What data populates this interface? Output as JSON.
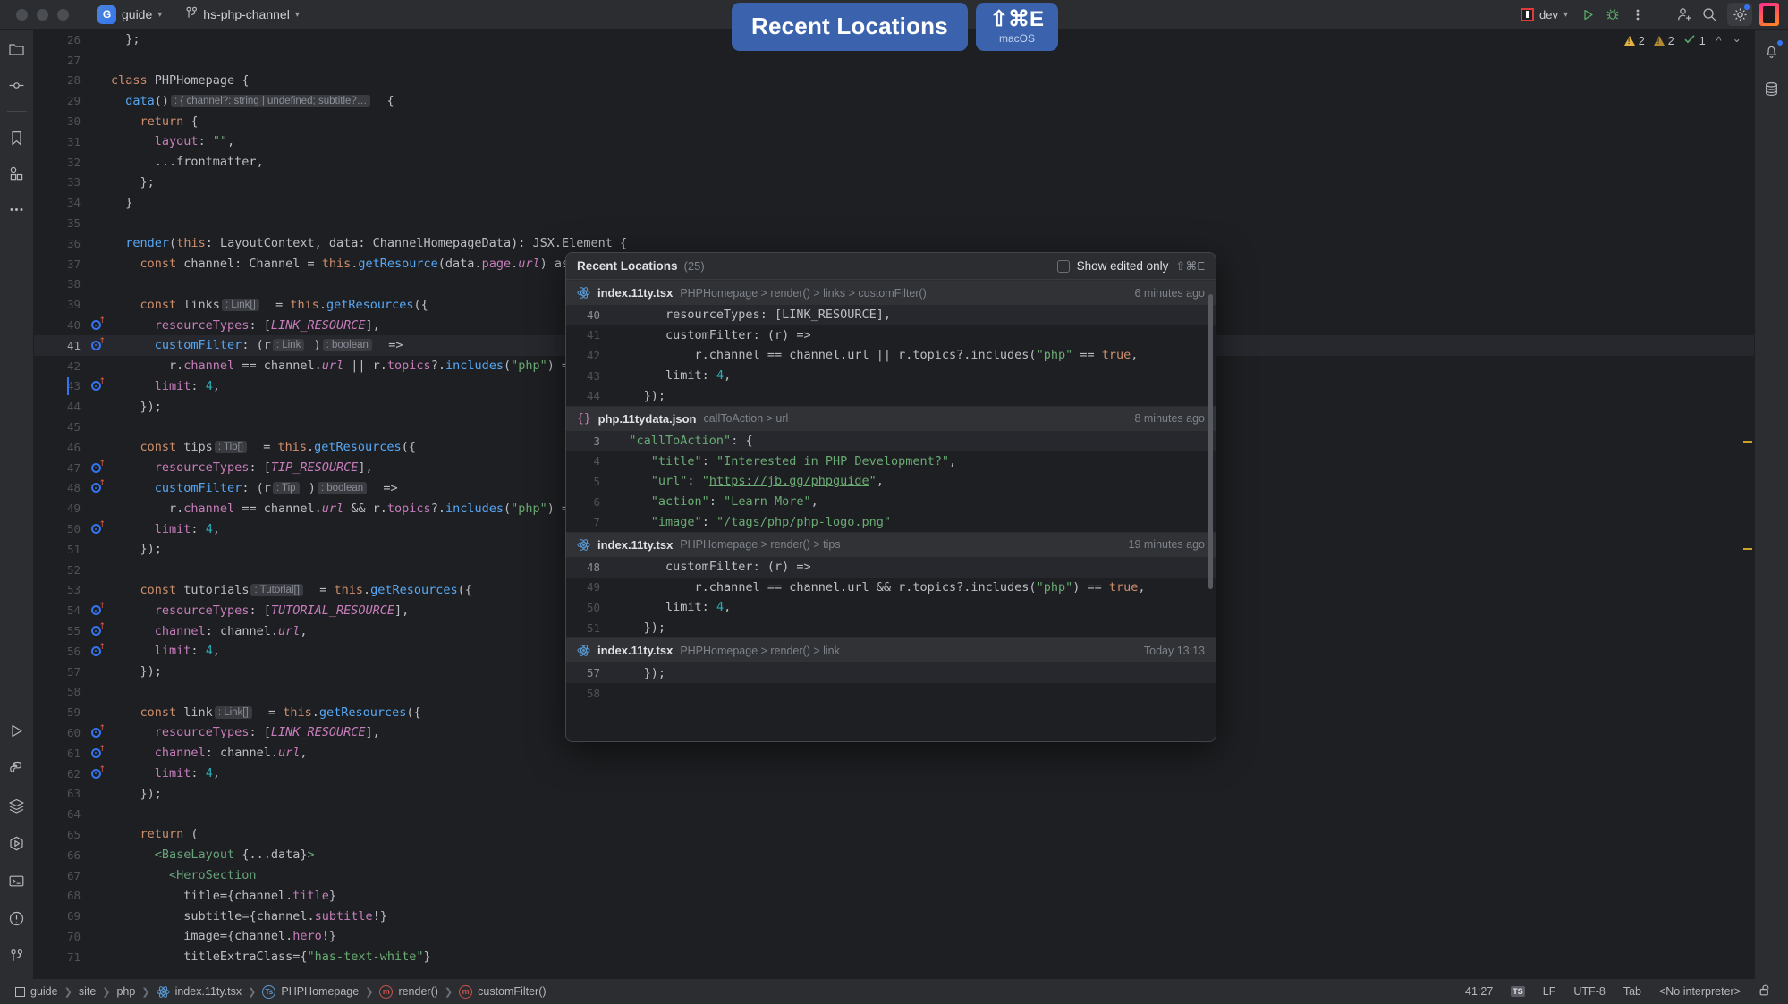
{
  "window": {
    "project_badge": "G",
    "project_name": "guide",
    "branch": "hs-php-channel"
  },
  "toolbar": {
    "run_config": "dev",
    "run_label": "run-icon",
    "debug_label": "debug-icon",
    "more_label": "more-options-icon",
    "search_label": "search-icon",
    "settings_label": "settings-icon",
    "add_user_label": "add-user-icon",
    "avatar_label": "user-avatar"
  },
  "banner": {
    "title": "Recent Locations",
    "shortcut": "⇧⌘E",
    "os": "macOS",
    "accent": "#3b63ad"
  },
  "inspections": {
    "warnings": "2",
    "weak_warnings": "2",
    "checks": "1"
  },
  "editor": {
    "file": "index.11ty.tsx",
    "lines": [
      {
        "n": "26",
        "marker": false,
        "html": "  <span class='def'>};</span>"
      },
      {
        "n": "27",
        "marker": false,
        "html": ""
      },
      {
        "n": "28",
        "marker": false,
        "html": "<span class='kw'>class</span> <span class='def'>PHPHomepage</span> {"
      },
      {
        "n": "29",
        "marker": false,
        "html": "  <span class='fn'>data</span>()<span class='hint'>: { channel?: string | undefined; subtitle?…</span>  {"
      },
      {
        "n": "30",
        "marker": false,
        "html": "    <span class='kw'>return</span> {"
      },
      {
        "n": "31",
        "marker": false,
        "html": "      <span class='prop'>layout</span>: <span class='str'>\"\"</span>,"
      },
      {
        "n": "32",
        "marker": false,
        "html": "      ...<span class='def'>frontmatter</span>,"
      },
      {
        "n": "33",
        "marker": false,
        "html": "    };"
      },
      {
        "n": "34",
        "marker": false,
        "html": "  }"
      },
      {
        "n": "35",
        "marker": false,
        "html": ""
      },
      {
        "n": "36",
        "marker": false,
        "html": "  <span class='fn'>render</span>(<span class='kw'>this</span>: LayoutContext, data: ChannelHomepageData): JSX.Element {"
      },
      {
        "n": "37",
        "marker": false,
        "html": "    <span class='kw'>const</span> channel: Channel = <span class='kw'>this</span>.<span class='fn'>getResource</span>(data.<span class='prop'>page</span>.<span class='const'>url</span>) as"
      },
      {
        "n": "38",
        "marker": false,
        "html": ""
      },
      {
        "n": "39",
        "marker": false,
        "html": "    <span class='kw'>const</span> <span class='def'>links</span><span class='hint'>: Link[]</span>  = <span class='kw'>this</span>.<span class='fn'>getResources</span>({"
      },
      {
        "n": "40",
        "marker": true,
        "html": "      <span class='prop'>resourceTypes</span>: [<span class='const'>LINK_RESOURCE</span>],"
      },
      {
        "n": "41",
        "marker": true,
        "html": "      <span class='fn'>customFilter</span>: (r<span class='hint'>: Link</span> )<span class='hint'>: boolean</span>  =>",
        "current": true
      },
      {
        "n": "42",
        "marker": false,
        "html": "        r.<span class='prop'>channel</span> == channel.<span class='const'>url</span> || r.<span class='prop'>topics</span>?.<span class='fn'>includes</span>(<span class='str'>\"php\"</span>) ="
      },
      {
        "n": "43",
        "marker": true,
        "html": "      <span class='prop'>limit</span>: <span class='num'>4</span>,",
        "caret": true
      },
      {
        "n": "44",
        "marker": false,
        "html": "    });"
      },
      {
        "n": "45",
        "marker": false,
        "html": ""
      },
      {
        "n": "46",
        "marker": false,
        "html": "    <span class='kw'>const</span> <span class='def'>tips</span><span class='hint'>: Tip[]</span>  = <span class='kw'>this</span>.<span class='fn'>getResources</span>({"
      },
      {
        "n": "47",
        "marker": true,
        "html": "      <span class='prop'>resourceTypes</span>: [<span class='const'>TIP_RESOURCE</span>],"
      },
      {
        "n": "48",
        "marker": true,
        "html": "      <span class='fn'>customFilter</span>: (r<span class='hint'>: Tip</span> )<span class='hint'>: boolean</span>  =>"
      },
      {
        "n": "49",
        "marker": false,
        "html": "        r.<span class='prop'>channel</span> == channel.<span class='const'>url</span> && r.<span class='prop'>topics</span>?.<span class='fn'>includes</span>(<span class='str'>\"php\"</span>) ="
      },
      {
        "n": "50",
        "marker": true,
        "html": "      <span class='prop'>limit</span>: <span class='num'>4</span>,"
      },
      {
        "n": "51",
        "marker": false,
        "html": "    });"
      },
      {
        "n": "52",
        "marker": false,
        "html": ""
      },
      {
        "n": "53",
        "marker": false,
        "html": "    <span class='kw'>const</span> <span class='def'>tutorials</span><span class='hint'>: Tutorial[]</span>  = <span class='kw'>this</span>.<span class='fn'>getResources</span>({"
      },
      {
        "n": "54",
        "marker": true,
        "html": "      <span class='prop'>resourceTypes</span>: [<span class='const'>TUTORIAL_RESOURCE</span>],"
      },
      {
        "n": "55",
        "marker": true,
        "html": "      <span class='prop'>channel</span>: channel.<span class='const'>url</span>,"
      },
      {
        "n": "56",
        "marker": true,
        "html": "      <span class='prop'>limit</span>: <span class='num'>4</span>,"
      },
      {
        "n": "57",
        "marker": false,
        "html": "    });"
      },
      {
        "n": "58",
        "marker": false,
        "html": ""
      },
      {
        "n": "59",
        "marker": false,
        "html": "    <span class='kw'>const</span> <span class='def'>link</span><span class='hint'>: Link[]</span>  = <span class='kw'>this</span>.<span class='fn'>getResources</span>({"
      },
      {
        "n": "60",
        "marker": true,
        "html": "      <span class='prop'>resourceTypes</span>: [<span class='const'>LINK_RESOURCE</span>],"
      },
      {
        "n": "61",
        "marker": true,
        "html": "      <span class='prop'>channel</span>: channel.<span class='const'>url</span>,"
      },
      {
        "n": "62",
        "marker": true,
        "html": "      <span class='prop'>limit</span>: <span class='num'>4</span>,"
      },
      {
        "n": "63",
        "marker": false,
        "html": "    });"
      },
      {
        "n": "64",
        "marker": false,
        "html": ""
      },
      {
        "n": "65",
        "marker": false,
        "html": "    <span class='kw'>return</span> ("
      },
      {
        "n": "66",
        "marker": false,
        "html": "      <span class='tag'>&lt;BaseLayout</span> {...data}<span class='tag'>&gt;</span>"
      },
      {
        "n": "67",
        "marker": false,
        "html": "        <span class='tag'>&lt;HeroSection</span>"
      },
      {
        "n": "68",
        "marker": false,
        "html": "          <span class='attr'>title</span>={channel.<span class='prop'>title</span>}"
      },
      {
        "n": "69",
        "marker": false,
        "html": "          <span class='attr'>subtitle</span>={channel.<span class='prop'>subtitle</span>!}"
      },
      {
        "n": "70",
        "marker": false,
        "html": "          <span class='attr'>image</span>={channel.<span class='prop'>hero</span>!}"
      },
      {
        "n": "71",
        "marker": false,
        "html": "          <span class='attr'>titleExtraClass</span>={<span class='str'>\"has-text-white\"</span>}"
      }
    ]
  },
  "popup": {
    "title": "Recent Locations",
    "count": "(25)",
    "filter_label": "Show edited only",
    "filter_shortcut": "⇧⌘E",
    "filter_checked": false,
    "groups": [
      {
        "icon": "react-icon",
        "file": "index.11ty.tsx",
        "breadcrumb": "PHPHomepage > render() > links > customFilter()",
        "time": "6 minutes ago",
        "lines": [
          {
            "n": "40",
            "lit": true,
            "html": "        <span class='ptext'>resourceTypes: [LINK_RESOURCE],</span>"
          },
          {
            "n": "41",
            "lit": false,
            "html": "        <span class='ptext'>customFilter: (r) =&gt;</span>"
          },
          {
            "n": "42",
            "lit": false,
            "html": "            <span class='ptext'>r.channel == channel.url || r.topics?.includes(</span><span class='str'>\"php\"</span><span class='ptext'> == </span><span class='kw'>true</span><span class='ptext'>,</span>"
          },
          {
            "n": "43",
            "lit": false,
            "html": "        <span class='ptext'>limit: </span><span class='num'>4</span><span class='ptext'>,</span>"
          },
          {
            "n": "44",
            "lit": false,
            "html": "     <span class='ptext'>});</span>"
          }
        ]
      },
      {
        "icon": "json-icon",
        "file": "php.11tydata.json",
        "breadcrumb": "callToAction > url",
        "time": "8 minutes ago",
        "lines": [
          {
            "n": "3",
            "lit": true,
            "html": "   <span class='str'>\"callToAction\"</span><span class='ptext'>: {</span>"
          },
          {
            "n": "4",
            "lit": false,
            "html": "      <span class='str'>\"title\"</span><span class='ptext'>: </span><span class='str'>\"Interested in PHP Development?\"</span><span class='ptext'>,</span>"
          },
          {
            "n": "5",
            "lit": false,
            "html": "      <span class='str'>\"url\"</span><span class='ptext'>: </span><span class='str'>\"</span><span class='link-u'>https://jb.gg/phpguide</span><span class='str'>\"</span><span class='ptext'>,</span>"
          },
          {
            "n": "6",
            "lit": false,
            "html": "      <span class='str'>\"action\"</span><span class='ptext'>: </span><span class='str'>\"Learn More\"</span><span class='ptext'>,</span>"
          },
          {
            "n": "7",
            "lit": false,
            "html": "      <span class='str'>\"image\"</span><span class='ptext'>: </span><span class='str'>\"/tags/php/php-logo.png\"</span>"
          }
        ]
      },
      {
        "icon": "react-icon",
        "file": "index.11ty.tsx",
        "breadcrumb": "PHPHomepage > render() > tips",
        "time": "19 minutes ago",
        "lines": [
          {
            "n": "48",
            "lit": true,
            "html": "        <span class='ptext'>customFilter: (r) =&gt;</span>"
          },
          {
            "n": "49",
            "lit": false,
            "html": "            <span class='ptext'>r.channel == channel.url &amp;&amp; r.topics?.includes(</span><span class='str'>\"php\"</span><span class='ptext'>) == </span><span class='kw'>true</span><span class='ptext'>,</span>"
          },
          {
            "n": "50",
            "lit": false,
            "html": "        <span class='ptext'>limit: </span><span class='num'>4</span><span class='ptext'>,</span>"
          },
          {
            "n": "51",
            "lit": false,
            "html": "     <span class='ptext'>});</span>"
          }
        ]
      },
      {
        "icon": "react-icon",
        "file": "index.11ty.tsx",
        "breadcrumb": "PHPHomepage > render() > link",
        "time": "Today 13:13",
        "lines": [
          {
            "n": "57",
            "lit": true,
            "html": "     <span class='ptext'>});</span>"
          },
          {
            "n": "58",
            "lit": false,
            "html": ""
          }
        ]
      }
    ]
  },
  "status_bar": {
    "breadcrumbs": [
      {
        "label": "guide",
        "icon": "module-icon"
      },
      {
        "label": "site",
        "icon": ""
      },
      {
        "label": "php",
        "icon": ""
      },
      {
        "label": "index.11ty.tsx",
        "icon": "react-icon"
      },
      {
        "label": "PHPHomepage",
        "icon": "ts-class-icon"
      },
      {
        "label": "render()",
        "icon": "method-icon"
      },
      {
        "label": "customFilter()",
        "icon": "method-icon"
      }
    ],
    "caret_position": "41:27",
    "file_type": "TS",
    "line_separator": "LF",
    "encoding": "UTF-8",
    "indent": "Tab",
    "interpreter": "<No interpreter>",
    "lock": "unlocked-icon"
  },
  "left_stripe": [
    {
      "name": "project-icon"
    },
    {
      "name": "commit-icon"
    },
    {
      "name": "bookmarks-icon"
    },
    {
      "name": "structure-icon"
    },
    {
      "name": "more-tool-windows-icon"
    }
  ],
  "left_stripe_bottom": [
    {
      "name": "run-tool-icon"
    },
    {
      "name": "python-packages-icon"
    },
    {
      "name": "services-icon"
    },
    {
      "name": "debug-tool-icon"
    },
    {
      "name": "terminal-icon"
    },
    {
      "name": "problems-icon"
    },
    {
      "name": "version-control-icon"
    }
  ],
  "right_stripe": [
    {
      "name": "notifications-icon",
      "badge": true
    },
    {
      "name": "database-icon",
      "badge": false
    }
  ]
}
